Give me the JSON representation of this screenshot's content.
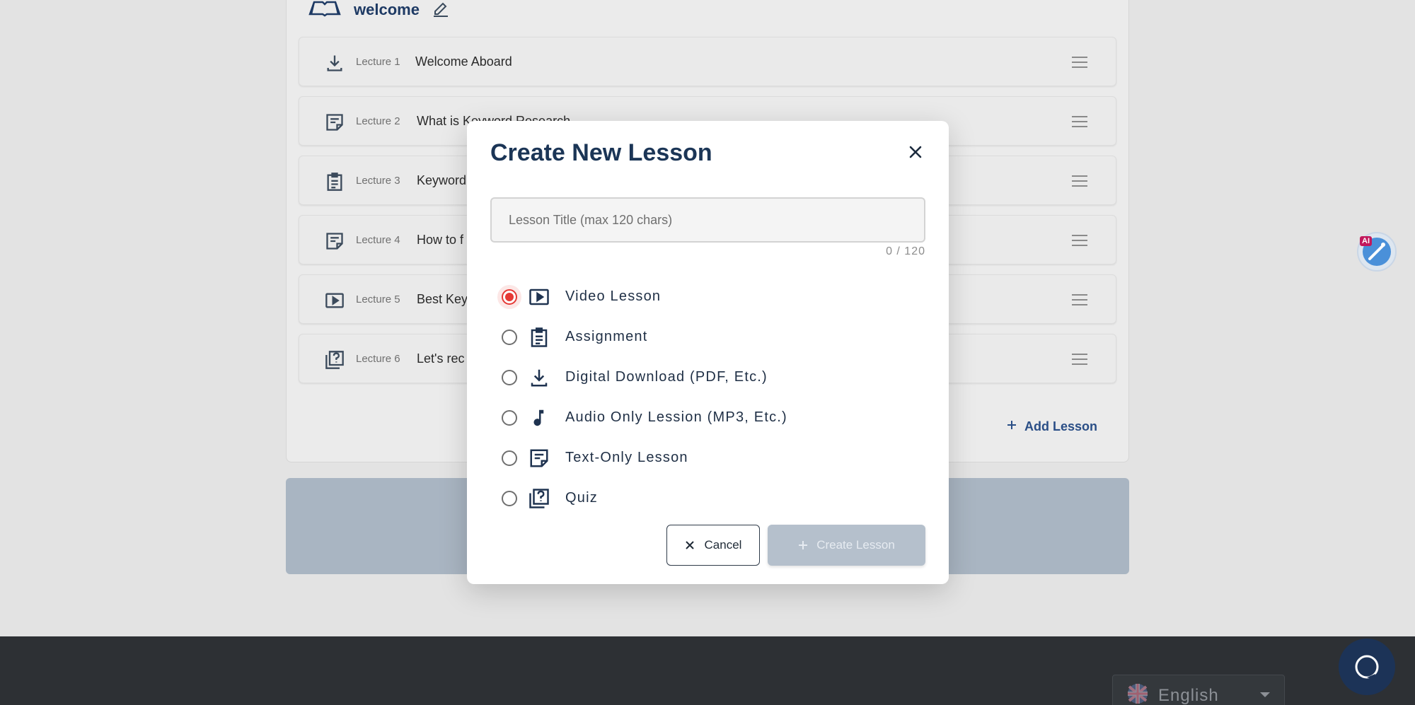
{
  "section": {
    "title": "welcome"
  },
  "lectures": [
    {
      "num": "Lecture 1",
      "title": "Welcome Aboard",
      "icon": "download-icon"
    },
    {
      "num": "Lecture 2",
      "title": "What is Keyword Research",
      "icon": "text-lesson-icon"
    },
    {
      "num": "Lecture 3",
      "title": "Keyword",
      "icon": "assignment-icon"
    },
    {
      "num": "Lecture 4",
      "title": "How to f",
      "icon": "text-lesson-icon"
    },
    {
      "num": "Lecture 5",
      "title": "Best Key",
      "icon": "video-icon"
    },
    {
      "num": "Lecture 6",
      "title": "Let's rec",
      "icon": "quiz-icon"
    }
  ],
  "add_lesson_label": "Add Lesson",
  "ai_badge_label": "AI",
  "footer": {
    "language": "English"
  },
  "modal": {
    "title": "Create New Lesson",
    "input_placeholder": "Lesson Title (max 120 chars)",
    "input_value": "",
    "counter": "0 / 120",
    "types": [
      {
        "label": "Video Lesson",
        "icon": "video-icon",
        "selected": true
      },
      {
        "label": "Assignment",
        "icon": "assignment-icon",
        "selected": false
      },
      {
        "label": "Digital Download (PDF, Etc.)",
        "icon": "download-icon",
        "selected": false
      },
      {
        "label": "Audio Only Lession (MP3, Etc.)",
        "icon": "music-note-icon",
        "selected": false
      },
      {
        "label": "Text-Only Lesson",
        "icon": "text-lesson-icon",
        "selected": false
      },
      {
        "label": "Quiz",
        "icon": "quiz-icon",
        "selected": false
      }
    ],
    "cancel_label": "Cancel",
    "create_label": "Create Lesson"
  },
  "colors": {
    "accent_radio": "#e53935",
    "heading": "#1b3556",
    "link": "#2a4e86",
    "create_disabled": "#b5c0cc",
    "footer_bg": "#2d3034"
  }
}
